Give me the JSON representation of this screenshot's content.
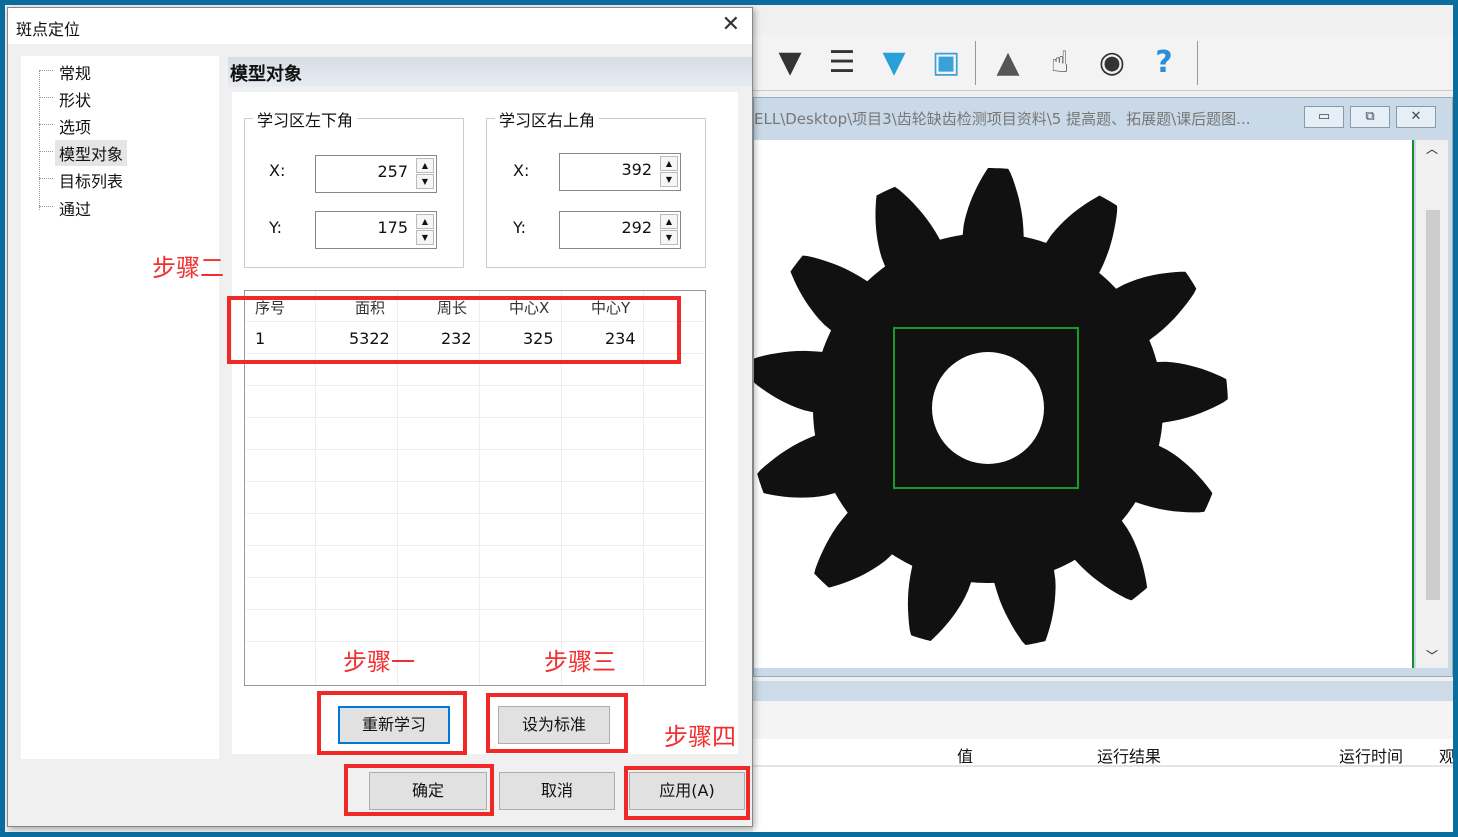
{
  "dialog": {
    "title": "斑点定位",
    "close": "✕"
  },
  "tree": [
    "常规",
    "形状",
    "选项",
    "模型对象",
    "目标列表",
    "通过"
  ],
  "tree_selected": "模型对象",
  "section_title": "模型对象",
  "lower_left": {
    "label": "学习区左下角",
    "x_label": "X:",
    "x": "257",
    "y_label": "Y:",
    "y": "175"
  },
  "upper_right": {
    "label": "学习区右上角",
    "x_label": "X:",
    "x": "392",
    "y_label": "Y:",
    "y": "292"
  },
  "table": {
    "headers": [
      "序号",
      "面积",
      "周长",
      "中心X",
      "中心Y"
    ],
    "rows": [
      [
        "1",
        "5322",
        "232",
        "325",
        "234"
      ]
    ]
  },
  "buttons": {
    "relearn": "重新学习",
    "set_standard": "设为标准",
    "ok": "确定",
    "cancel": "取消",
    "apply": "应用(A)"
  },
  "annotations": {
    "step1": "步骤一",
    "step2": "步骤二",
    "step3": "步骤三",
    "step4": "步骤四"
  },
  "image_window": {
    "title": "ELL\\Desktop\\项目3\\齿轮缺齿检测项目资料\\5 提高题、拓展题\\课后题图...",
    "minimize": "▭",
    "restore": "⧉",
    "close": "✕"
  },
  "toolbar_icons": [
    "lock-funnel-icon",
    "filter-icon",
    "blue-triangle-icon",
    "monitor-icon",
    "triangle-icon",
    "hand-icon",
    "eye-icon",
    "help-icon"
  ],
  "results": {
    "headers": [
      "值",
      "运行结果",
      "运行时间",
      "观"
    ]
  },
  "colors": {
    "annotation_red": "#f02828",
    "roi_green": "#1a9a2a",
    "frame_blue": "#0b6c9e"
  }
}
